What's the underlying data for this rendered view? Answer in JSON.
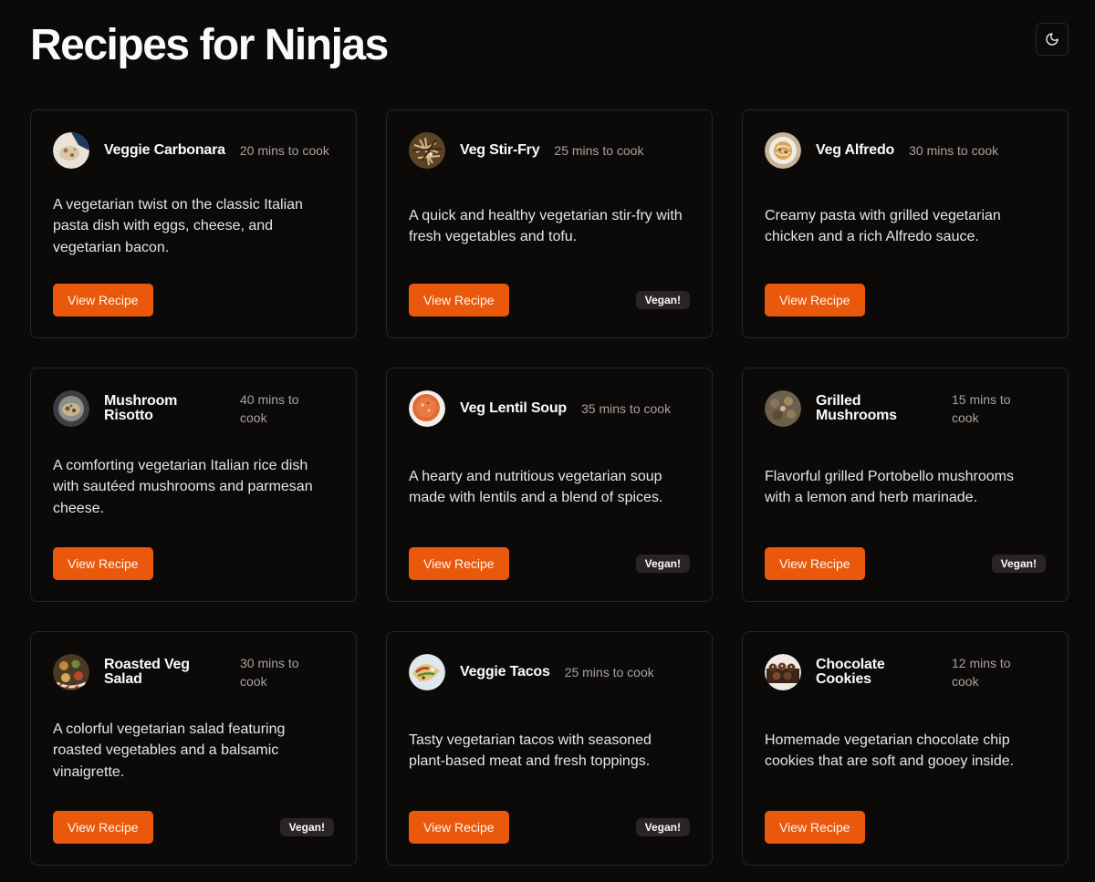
{
  "header": {
    "title": "Recipes for Ninjas",
    "theme_toggle_icon": "moon-icon"
  },
  "colors": {
    "background": "#0c0a09",
    "card_border": "#292524",
    "accent": "#ea580c",
    "muted_text": "#a8a29e",
    "badge_bg": "#292524"
  },
  "button_label": "View Recipe",
  "badge_label": "Vegan!",
  "recipes": [
    {
      "title": "Veggie Carbonara",
      "cook_time": "20 mins to cook",
      "description": "A vegetarian twist on the classic Italian pasta dish with eggs, cheese, and vegetarian bacon.",
      "vegan": false,
      "thumbnail": "carbonara-photo"
    },
    {
      "title": "Veg Stir-Fry",
      "cook_time": "25 mins to cook",
      "description": "A quick and healthy vegetarian stir-fry with fresh vegetables and tofu.",
      "vegan": true,
      "thumbnail": "stir-fry-photo"
    },
    {
      "title": "Veg Alfredo",
      "cook_time": "30 mins to cook",
      "description": "Creamy pasta with grilled vegetarian chicken and a rich Alfredo sauce.",
      "vegan": false,
      "thumbnail": "alfredo-photo"
    },
    {
      "title": "Mushroom Risotto",
      "cook_time": "40 mins to cook",
      "description": "A comforting vegetarian Italian rice dish with sautéed mushrooms and parmesan cheese.",
      "vegan": false,
      "thumbnail": "risotto-photo"
    },
    {
      "title": "Veg Lentil Soup",
      "cook_time": "35 mins to cook",
      "description": "A hearty and nutritious vegetarian soup made with lentils and a blend of spices.",
      "vegan": true,
      "thumbnail": "lentil-soup-photo"
    },
    {
      "title": "Grilled Mushrooms",
      "cook_time": "15 mins to cook",
      "description": "Flavorful grilled Portobello mushrooms with a lemon and herb marinade.",
      "vegan": true,
      "thumbnail": "grilled-mushrooms-photo"
    },
    {
      "title": "Roasted Veg Salad",
      "cook_time": "30 mins to cook",
      "description": "A colorful vegetarian salad featuring roasted vegetables and a balsamic vinaigrette.",
      "vegan": true,
      "thumbnail": "salad-photo"
    },
    {
      "title": "Veggie Tacos",
      "cook_time": "25 mins to cook",
      "description": "Tasty vegetarian tacos with seasoned plant-based meat and fresh toppings.",
      "vegan": true,
      "thumbnail": "tacos-photo"
    },
    {
      "title": "Chocolate Cookies",
      "cook_time": "12 mins to cook",
      "description": "Homemade vegetarian chocolate chip cookies that are soft and gooey inside.",
      "vegan": false,
      "thumbnail": "cookies-photo"
    }
  ]
}
